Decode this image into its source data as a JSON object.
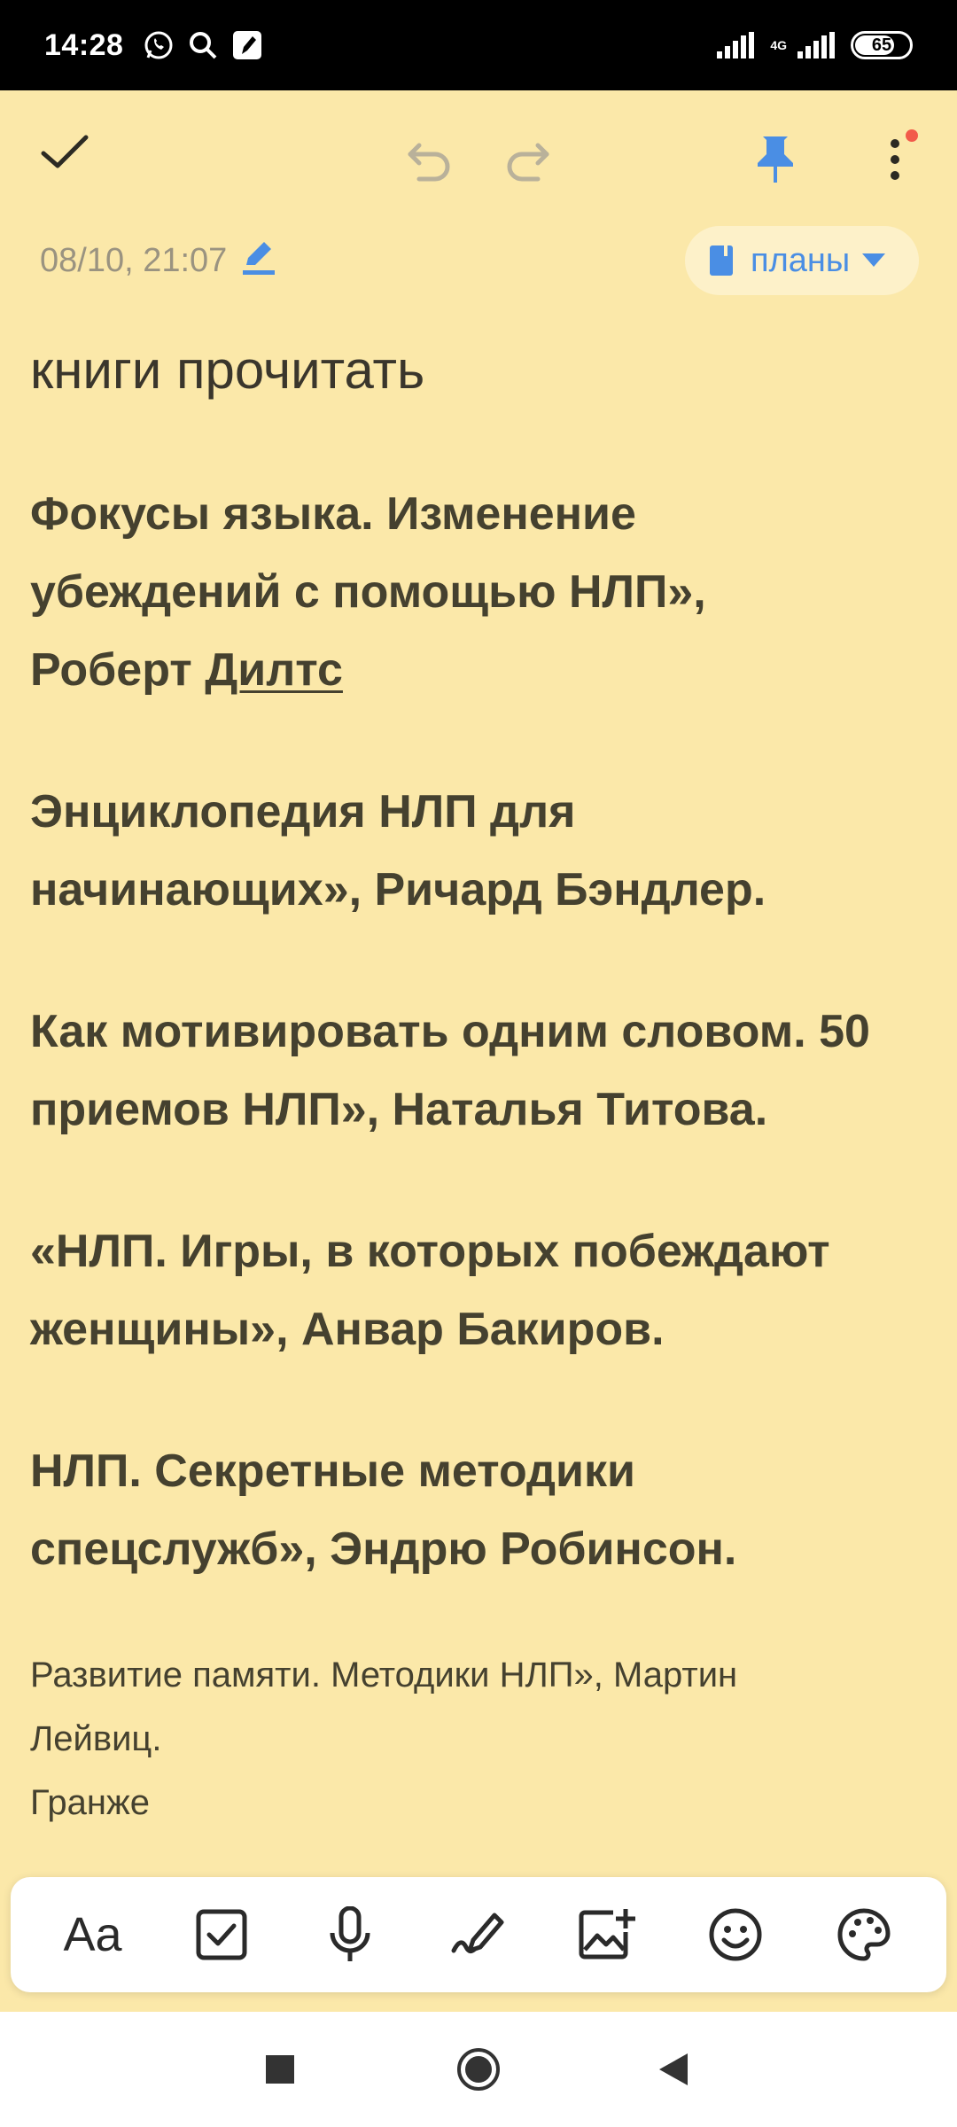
{
  "status_bar": {
    "time": "14:28",
    "network": "4G",
    "battery": "65",
    "icons": [
      "whatsapp-icon",
      "search-icon",
      "notes-app-icon",
      "signal-icon",
      "signal-4g-icon",
      "battery-icon"
    ]
  },
  "toolbar": {
    "icons": [
      "check-icon",
      "undo-icon",
      "redo-icon",
      "pin-icon",
      "more-vert-icon"
    ],
    "accent_color": "#4a8ee4",
    "notification_dot_color": "#f25a4a"
  },
  "meta": {
    "date": "08/10, 21:07",
    "folder": "планы"
  },
  "note": {
    "title": "книги прочитать",
    "entries": [
      {
        "lines": [
          "Фокусы языка. Изменение",
          "убеждений с помощью НЛП»,"
        ],
        "tail_plain": "Роберт ",
        "tail_underlined": "Дилтс"
      },
      {
        "lines": [
          "Энциклопедия НЛП для",
          "начинающих», Ричард Бэндлер."
        ]
      },
      {
        "lines": [
          "Как мотивировать одним словом. 50",
          "приемов НЛП», Наталья Титова."
        ]
      },
      {
        "lines": [
          "«НЛП. Игры, в которых побеждают",
          "женщины», Анвар Бакиров."
        ]
      },
      {
        "lines": [
          "НЛП. Секретные методики",
          "спецслужб», Эндрю Робинсон."
        ]
      }
    ],
    "small_entry": {
      "lines": [
        "Развитие памяти. Методики НЛП», Мартин",
        "Лейвиц.",
        "Гранже"
      ]
    }
  },
  "format_bar": {
    "text_style_label": "Aa",
    "icons": [
      "text-format-icon",
      "checkbox-icon",
      "microphone-icon",
      "draw-icon",
      "add-image-icon",
      "emoji-icon",
      "palette-icon"
    ]
  },
  "nav_bar": {
    "icons": [
      "recents-square-icon",
      "home-circle-icon",
      "back-triangle-icon"
    ]
  },
  "colors": {
    "background": "#fbe8a9",
    "chip_background": "#fdf1c9",
    "text": "#45412f"
  }
}
